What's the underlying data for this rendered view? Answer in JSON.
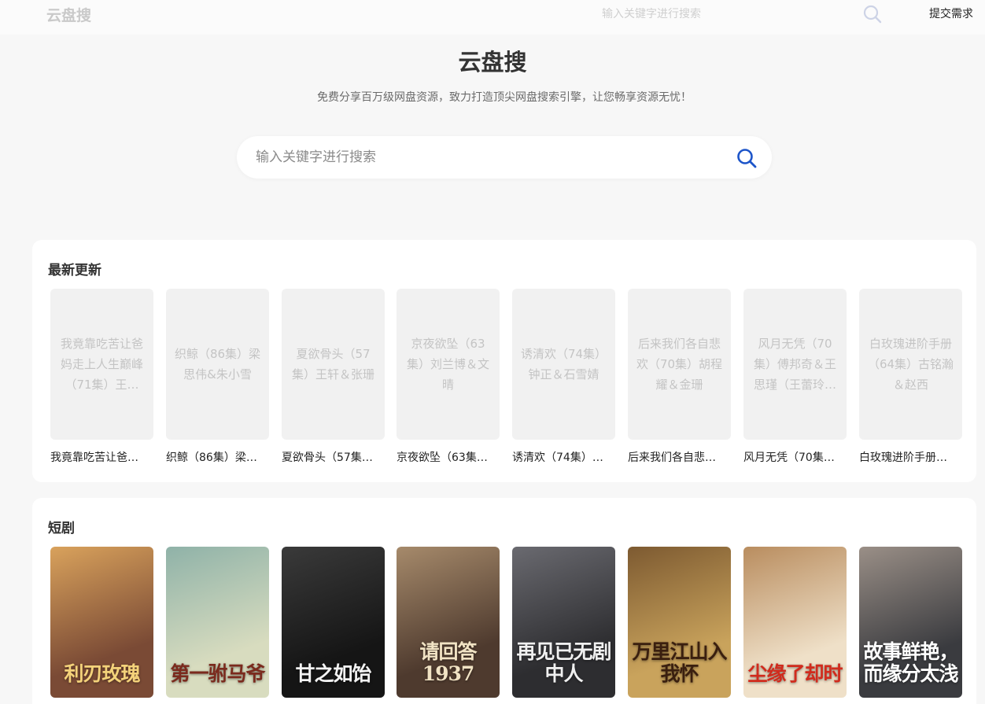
{
  "header": {
    "brand": "云盘搜",
    "search_placeholder": "输入关键字进行搜索",
    "submit_label": "提交需求"
  },
  "hero": {
    "title": "云盘搜",
    "subtitle": "免费分享百万级网盘资源，致力打造顶尖网盘搜索引擎，让您畅享资源无忧！",
    "search_placeholder": "输入关键字进行搜索"
  },
  "latest": {
    "title": "最新更新",
    "items": [
      {
        "full": "我竟靠吃苦让爸妈走上人生巅峰（71集）王…",
        "caption": "我竟靠吃苦让爸…"
      },
      {
        "full": "织鲸（86集）梁思伟&朱小雪",
        "caption": "织鲸（86集）梁…"
      },
      {
        "full": "夏欲骨头（57集）王轩＆张珊",
        "caption": "夏欲骨头（57集…"
      },
      {
        "full": "京夜欲坠（63集）刘兰博＆文晴",
        "caption": "京夜欲坠（63集…"
      },
      {
        "full": "诱清欢（74集）钟正＆石雪婧",
        "caption": "诱清欢（74集）…"
      },
      {
        "full": "后来我们各自悲欢（70集）胡程耀＆金珊",
        "caption": "后来我们各自悲…"
      },
      {
        "full": "风月无凭（70集）傅邦奇＆王思瑾（王蕾玲…",
        "caption": "风月无凭（70集…"
      },
      {
        "full": "白玫瑰进阶手册（64集）古铭瀚＆赵西",
        "caption": "白玫瑰进阶手册…"
      }
    ]
  },
  "drama": {
    "title": "短剧",
    "posters": [
      {
        "title": "利刃玫瑰",
        "bg": "#7a4a35",
        "bg2": "#d9a25c",
        "fg": "#f4d27a"
      },
      {
        "title": "第一驸马爷",
        "bg": "#d8dcbf",
        "bg2": "#8fb2a8",
        "fg": "#7b2a1d"
      },
      {
        "title": "甘之如饴",
        "bg": "#151515",
        "bg2": "#3a3a3a",
        "fg": "#f3f3f3"
      },
      {
        "title": "请回答1937",
        "bg": "#4e3a2e",
        "bg2": "#a68a6b",
        "fg": "#f1e3c4"
      },
      {
        "title": "再见已无剧中人",
        "bg": "#2d2d30",
        "bg2": "#6a6a70",
        "fg": "#f0f0f0"
      },
      {
        "title": "万里江山入我怀",
        "bg": "#c9a35c",
        "bg2": "#7d5a31",
        "fg": "#3a1f0f"
      },
      {
        "title": "尘缘了却时",
        "bg": "#efe0c8",
        "bg2": "#b98d5f",
        "fg": "#d12b1d"
      },
      {
        "title": "故事鲜艳，而缘分太浅",
        "bg": "#3a3b3f",
        "bg2": "#9a8f87",
        "fg": "#ffffff"
      }
    ]
  },
  "colors": {
    "accent": "#1d55c9",
    "page_bg": "#f7f7f7",
    "card_bg": "#ffffff",
    "placeholder_bg": "#f1f1f1"
  }
}
